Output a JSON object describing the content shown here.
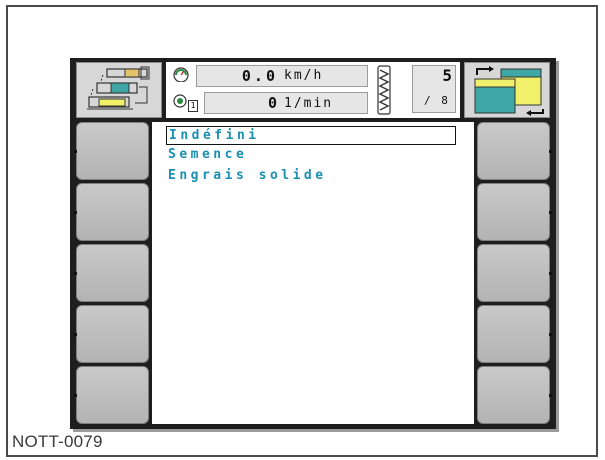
{
  "caption": "NOTT-0079",
  "header": {
    "speed_value": "0.0",
    "speed_unit": "km/h",
    "rpm_value": "0",
    "rpm_unit": "1/min",
    "rpm_sub": "1",
    "section_count": "5",
    "section_sub": "/ 8"
  },
  "list": {
    "items": [
      {
        "label": "Indéfini",
        "selected": true
      },
      {
        "label": "Semence",
        "selected": false
      },
      {
        "label": "Engrais solide",
        "selected": false
      }
    ]
  },
  "colors": {
    "list_text": "#1a8fb0",
    "bezel": "#1e1e1e",
    "softkey": "#c0c0c0"
  }
}
